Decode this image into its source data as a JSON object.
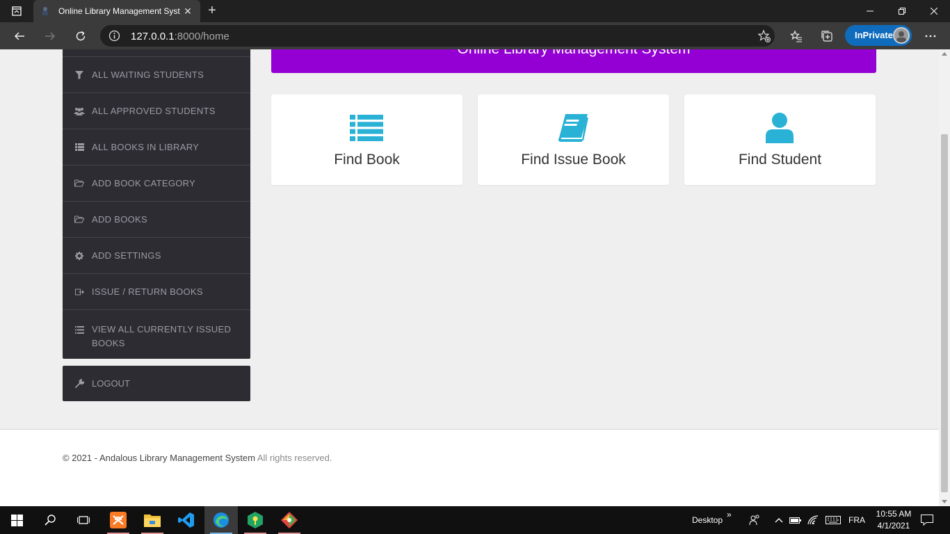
{
  "browser": {
    "tab_title": "Online Library Management Syst",
    "url_host": "127.0.0.1",
    "url_rest": ":8000/home",
    "inprivate_label": "InPrivate"
  },
  "sidebar": {
    "items": [
      {
        "label": "ALL WAITING STUDENTS",
        "icon": "filter-icon"
      },
      {
        "label": "ALL APPROVED STUDENTS",
        "icon": "users-icon"
      },
      {
        "label": "ALL BOOKS IN LIBRARY",
        "icon": "list-icon"
      },
      {
        "label": "ADD BOOK CATEGORY",
        "icon": "folder-open-icon"
      },
      {
        "label": "ADD BOOKS",
        "icon": "folder-open-icon"
      },
      {
        "label": "ADD SETTINGS",
        "icon": "gear-icon"
      },
      {
        "label": "ISSUE / RETURN BOOKS",
        "icon": "share-icon"
      },
      {
        "label": "VIEW ALL CURRENTLY ISSUED BOOKS",
        "icon": "list-icon"
      }
    ],
    "logout_label": "LOGOUT"
  },
  "header": {
    "title": "Online Library Management System"
  },
  "cards": [
    {
      "label": "Find Book",
      "icon": "list-icon"
    },
    {
      "label": "Find Issue Book",
      "icon": "book-icon"
    },
    {
      "label": "Find Student",
      "icon": "user-icon"
    }
  ],
  "footer": {
    "strong": "© 2021 - Andalous Library Management System",
    "rest": " All rights reserved."
  },
  "taskbar": {
    "desktop_label": "Desktop",
    "lang": "FRA",
    "time": "10:55 AM",
    "date": "4/1/2021"
  },
  "colors": {
    "accent_purple": "#9400d3",
    "icon_cyan": "#29b2d6",
    "sidebar_bg": "#2d2c33"
  }
}
